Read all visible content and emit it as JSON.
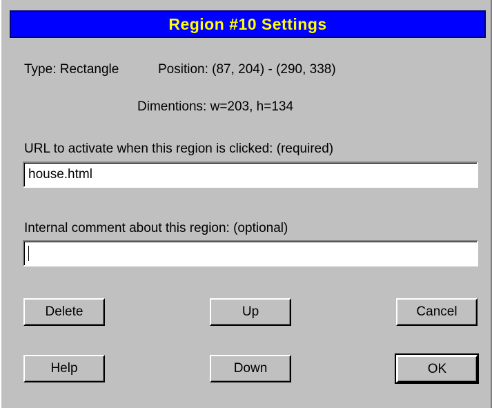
{
  "title": "Region #10 Settings",
  "info": {
    "type": "Type: Rectangle",
    "position": "Position:  (87, 204) - (290, 338)",
    "dimensions": "Dimentions:  w=203, h=134"
  },
  "url_field": {
    "label": "URL to activate when this region is clicked: (required)",
    "value": "house.html"
  },
  "comment_field": {
    "label": "Internal comment about this region: (optional)",
    "value": ""
  },
  "buttons": {
    "delete": "Delete",
    "up": "Up",
    "cancel": "Cancel",
    "help": "Help",
    "down": "Down",
    "ok": "OK"
  },
  "colors": {
    "dialog_bg": "#c0c0c0",
    "title_bg": "#0000ff",
    "title_text": "#ffff00"
  }
}
